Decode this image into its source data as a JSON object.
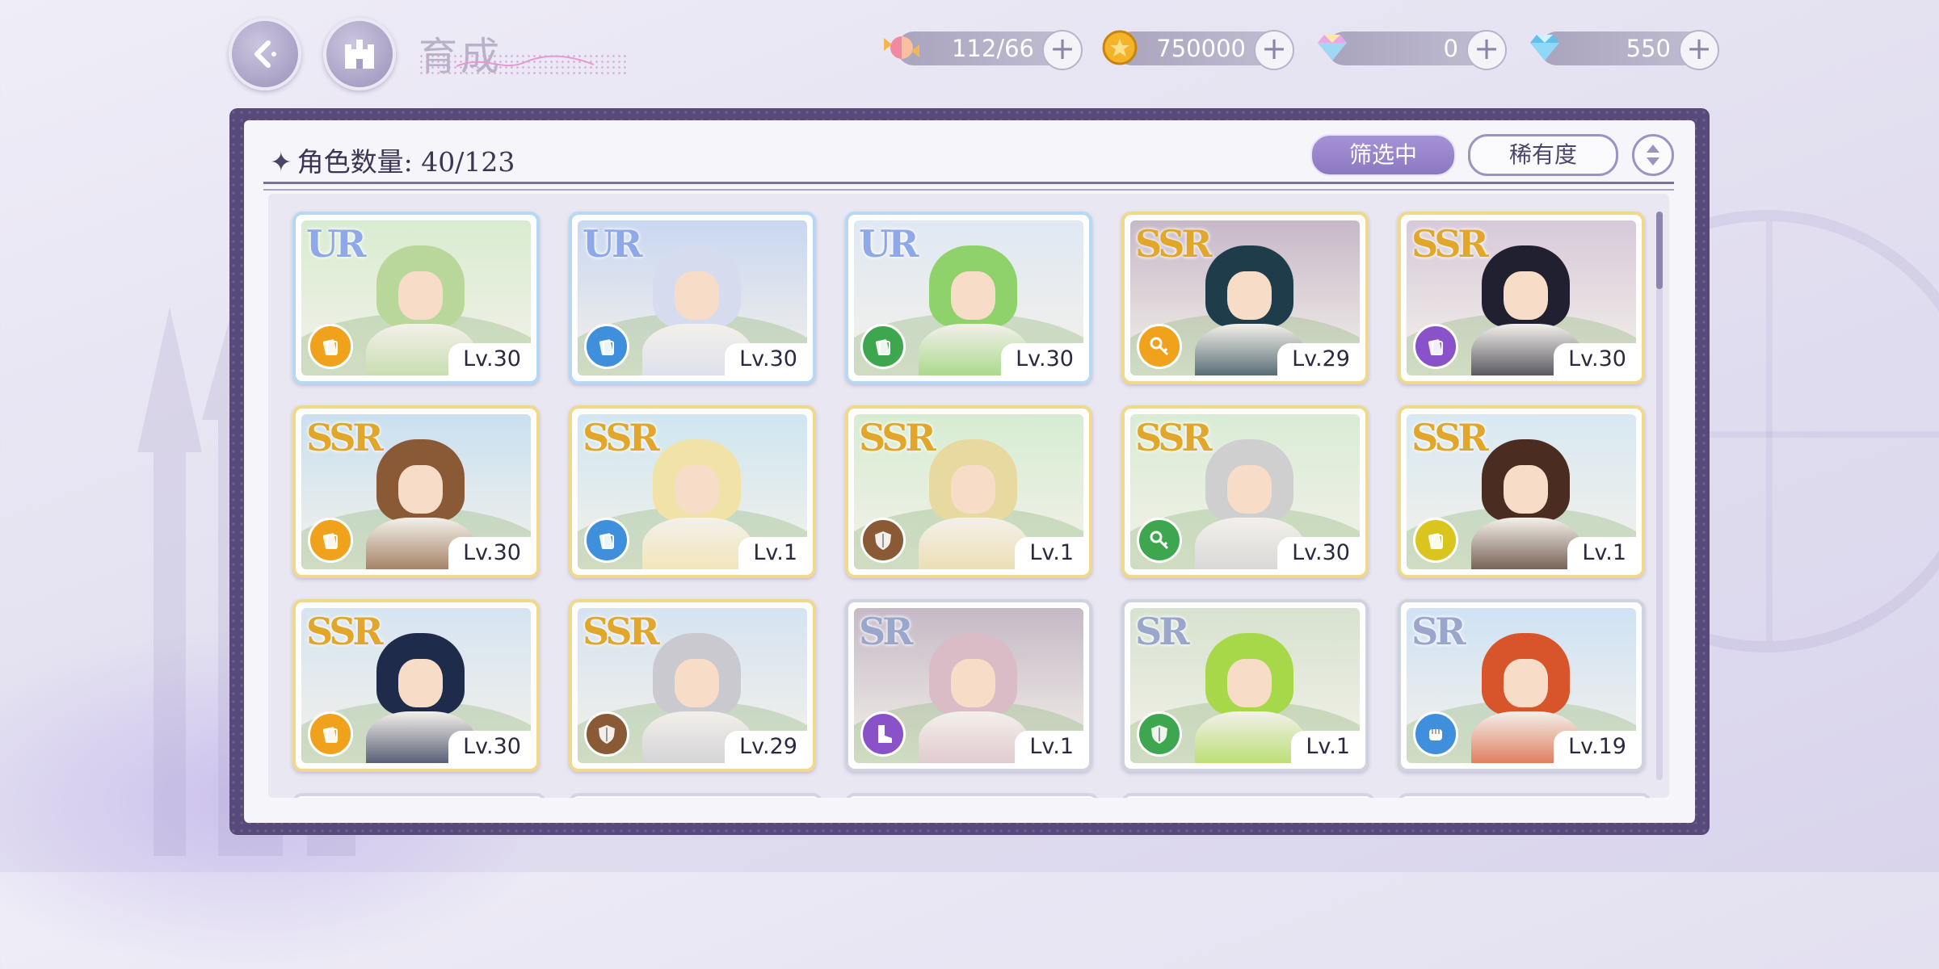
{
  "header": {
    "title": "育成",
    "resources": [
      {
        "name": "candy",
        "value": "112/66",
        "icon": "candy-icon"
      },
      {
        "name": "gold",
        "value": "750000",
        "icon": "gold-coin-icon"
      },
      {
        "name": "rainbow-gem",
        "value": "0",
        "icon": "rainbow-diamond-icon"
      },
      {
        "name": "blue-gem",
        "value": "550",
        "icon": "blue-diamond-icon"
      }
    ],
    "plus_label": "+"
  },
  "panel": {
    "count_label": "角色数量: 40/123",
    "filter_label": "筛选中",
    "sort_label": "稀有度"
  },
  "colors": {
    "frame": "#574a7a",
    "filter_button": "#8c78c2",
    "elem_orange": "#f0a21c",
    "elem_blue": "#3f8fdc",
    "elem_green": "#3ea64e",
    "elem_purple": "#8a52c8",
    "elem_brown": "#8a5a36",
    "elem_yellow": "#d9c51e"
  },
  "cards": [
    {
      "rarity": "UR",
      "level": "Lv.30",
      "element": "orange",
      "icon": "book-icon",
      "hair": "#b9d79a",
      "sky": "#d8ecd0"
    },
    {
      "rarity": "UR",
      "level": "Lv.30",
      "element": "blue",
      "icon": "book-icon",
      "hair": "#d6dbee",
      "sky": "#c9d7f1"
    },
    {
      "rarity": "UR",
      "level": "Lv.30",
      "element": "green",
      "icon": "book-icon",
      "hair": "#8fd16a",
      "sky": "#dfe8f3"
    },
    {
      "rarity": "SSR",
      "level": "Lv.29",
      "element": "orange",
      "icon": "key-icon",
      "hair": "#1f3c4b",
      "sky": "#c7b8c8"
    },
    {
      "rarity": "SSR",
      "level": "Lv.30",
      "element": "purple",
      "icon": "book-icon",
      "hair": "#202030",
      "sky": "#d7c9d9"
    },
    {
      "rarity": "SSR",
      "level": "Lv.30",
      "element": "orange",
      "icon": "book-icon",
      "hair": "#8a5a36",
      "sky": "#c9e0f0"
    },
    {
      "rarity": "SSR",
      "level": "Lv.1",
      "element": "blue",
      "icon": "book-icon",
      "hair": "#f1e2a8",
      "sky": "#cfe6f0"
    },
    {
      "rarity": "SSR",
      "level": "Lv.1",
      "element": "brown",
      "icon": "shield-icon",
      "hair": "#e8d9a0",
      "sky": "#d6ecd2"
    },
    {
      "rarity": "SSR",
      "level": "Lv.30",
      "element": "green",
      "icon": "key-icon",
      "hair": "#cfcfcf",
      "sky": "#d9ecd5"
    },
    {
      "rarity": "SSR",
      "level": "Lv.1",
      "element": "yellow",
      "icon": "book-icon",
      "hair": "#4a2d20",
      "sky": "#d8e8f2"
    },
    {
      "rarity": "SSR",
      "level": "Lv.30",
      "element": "orange",
      "icon": "book-icon",
      "hair": "#1f2b4a",
      "sky": "#d6e4f1"
    },
    {
      "rarity": "SSR",
      "level": "Lv.29",
      "element": "brown",
      "icon": "shield-icon",
      "hair": "#c9c9cf",
      "sky": "#d5e3f0"
    },
    {
      "rarity": "SR",
      "level": "Lv.1",
      "element": "purple",
      "icon": "boot-icon",
      "hair": "#d9bcc5",
      "sky": "#c5b9c6"
    },
    {
      "rarity": "SR",
      "level": "Lv.1",
      "element": "green",
      "icon": "shield-icon",
      "hair": "#a7d84a",
      "sky": "#d7e2cf"
    },
    {
      "rarity": "SR",
      "level": "Lv.19",
      "element": "blue",
      "icon": "fist-icon",
      "hair": "#d8552c",
      "sky": "#cfe2f4"
    }
  ]
}
